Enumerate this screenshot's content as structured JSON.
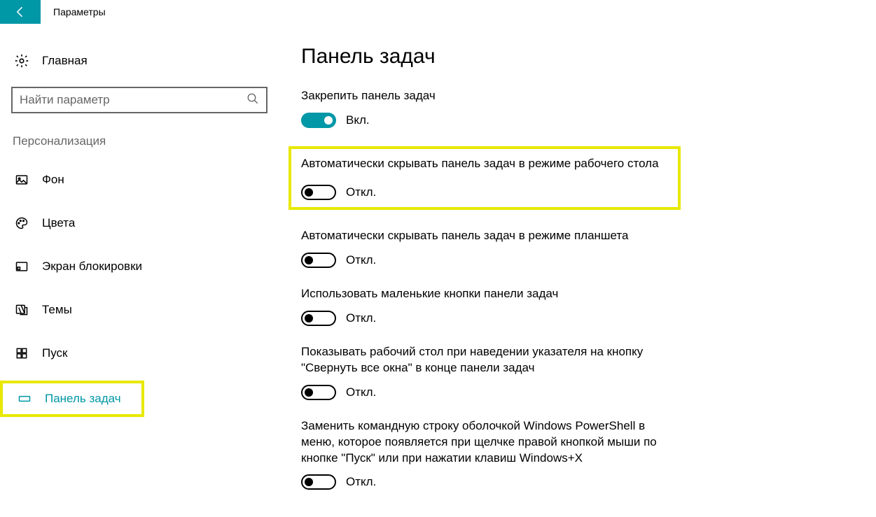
{
  "titlebar": {
    "title": "Параметры"
  },
  "sidebar": {
    "home_label": "Главная",
    "search_placeholder": "Найти параметр",
    "category_label": "Персонализация",
    "items": [
      {
        "label": "Фон"
      },
      {
        "label": "Цвета"
      },
      {
        "label": "Экран блокировки"
      },
      {
        "label": "Темы"
      },
      {
        "label": "Пуск"
      },
      {
        "label": "Панель задач"
      }
    ]
  },
  "main": {
    "heading": "Панель задач",
    "state_on": "Вкл.",
    "state_off": "Откл.",
    "settings": [
      {
        "label": "Закрепить панель задач",
        "on": true
      },
      {
        "label": "Автоматически скрывать панель задач в режиме рабочего стола",
        "on": false
      },
      {
        "label": "Автоматически скрывать панель задач в режиме планшета",
        "on": false
      },
      {
        "label": "Использовать маленькие кнопки панели задач",
        "on": false
      },
      {
        "label": "Показывать рабочий стол при наведении указателя на кнопку \"Свернуть все окна\" в конце панели задач",
        "on": false
      },
      {
        "label": "Заменить командную строку оболочкой Windows PowerShell в меню, которое появляется при щелчке правой кнопкой мыши по кнопке \"Пуск\" или при нажатии клавиш Windows+X",
        "on": false
      }
    ]
  }
}
